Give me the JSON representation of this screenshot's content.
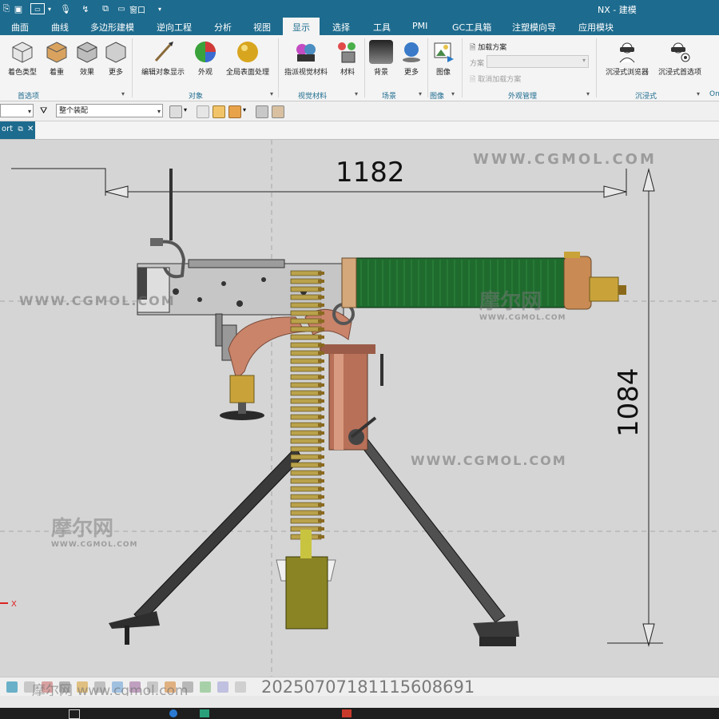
{
  "window": {
    "title": "NX - 建模",
    "window_menu": "窗口"
  },
  "menu": {
    "tabs": [
      "曲面",
      "曲线",
      "多边形建模",
      "逆向工程",
      "分析",
      "视图",
      "显示",
      "选择",
      "工具",
      "PMI",
      "GC工具箱",
      "注塑模向导",
      "应用模块"
    ],
    "active": "显示"
  },
  "ribbon": {
    "groups": {
      "prefs": {
        "label": "首选项",
        "buttons": [
          "着色类型",
          "着重",
          "效果",
          "更多"
        ]
      },
      "object": {
        "label": "对象",
        "buttons": [
          "编辑对象显示",
          "外观",
          "全局表面处理"
        ]
      },
      "visual_material": {
        "label": "视觉材料",
        "buttons": [
          "指派视觉材料",
          "材料"
        ]
      },
      "scene": {
        "label": "场景",
        "buttons": [
          "背景",
          "更多"
        ]
      },
      "image": {
        "label": "图像",
        "buttons": [
          "图像"
        ]
      },
      "appearance": {
        "label": "外观管理",
        "load_scheme": "加载方案",
        "scheme_label": "方案",
        "scheme_value": "",
        "cancel_load": "取消加载方案"
      },
      "immersive": {
        "label": "沉浸式",
        "buttons": [
          "沉浸式浏览器",
          "沉浸式首选项"
        ]
      },
      "more_label": "On"
    }
  },
  "toolbar": {
    "filter_value": "",
    "assembly_scope": "整个装配"
  },
  "view_tab": {
    "label": "ort"
  },
  "viewport": {
    "dimension_width": "1182",
    "dimension_height": "1084",
    "watermark_url": "WWW.CGMOL.COM",
    "watermark_cn": "摩尔网",
    "axis_label": "X"
  },
  "overlay": {
    "timestamp": "20250707181115608691",
    "footer_watermark": "摩尔网 www.cgmol.com"
  },
  "colors": {
    "accent": "#1d6b8e",
    "jacket_green": "#1f6b2e",
    "copper": "#c9846a",
    "brass": "#c9a33a",
    "magazine": "#8a8424"
  }
}
